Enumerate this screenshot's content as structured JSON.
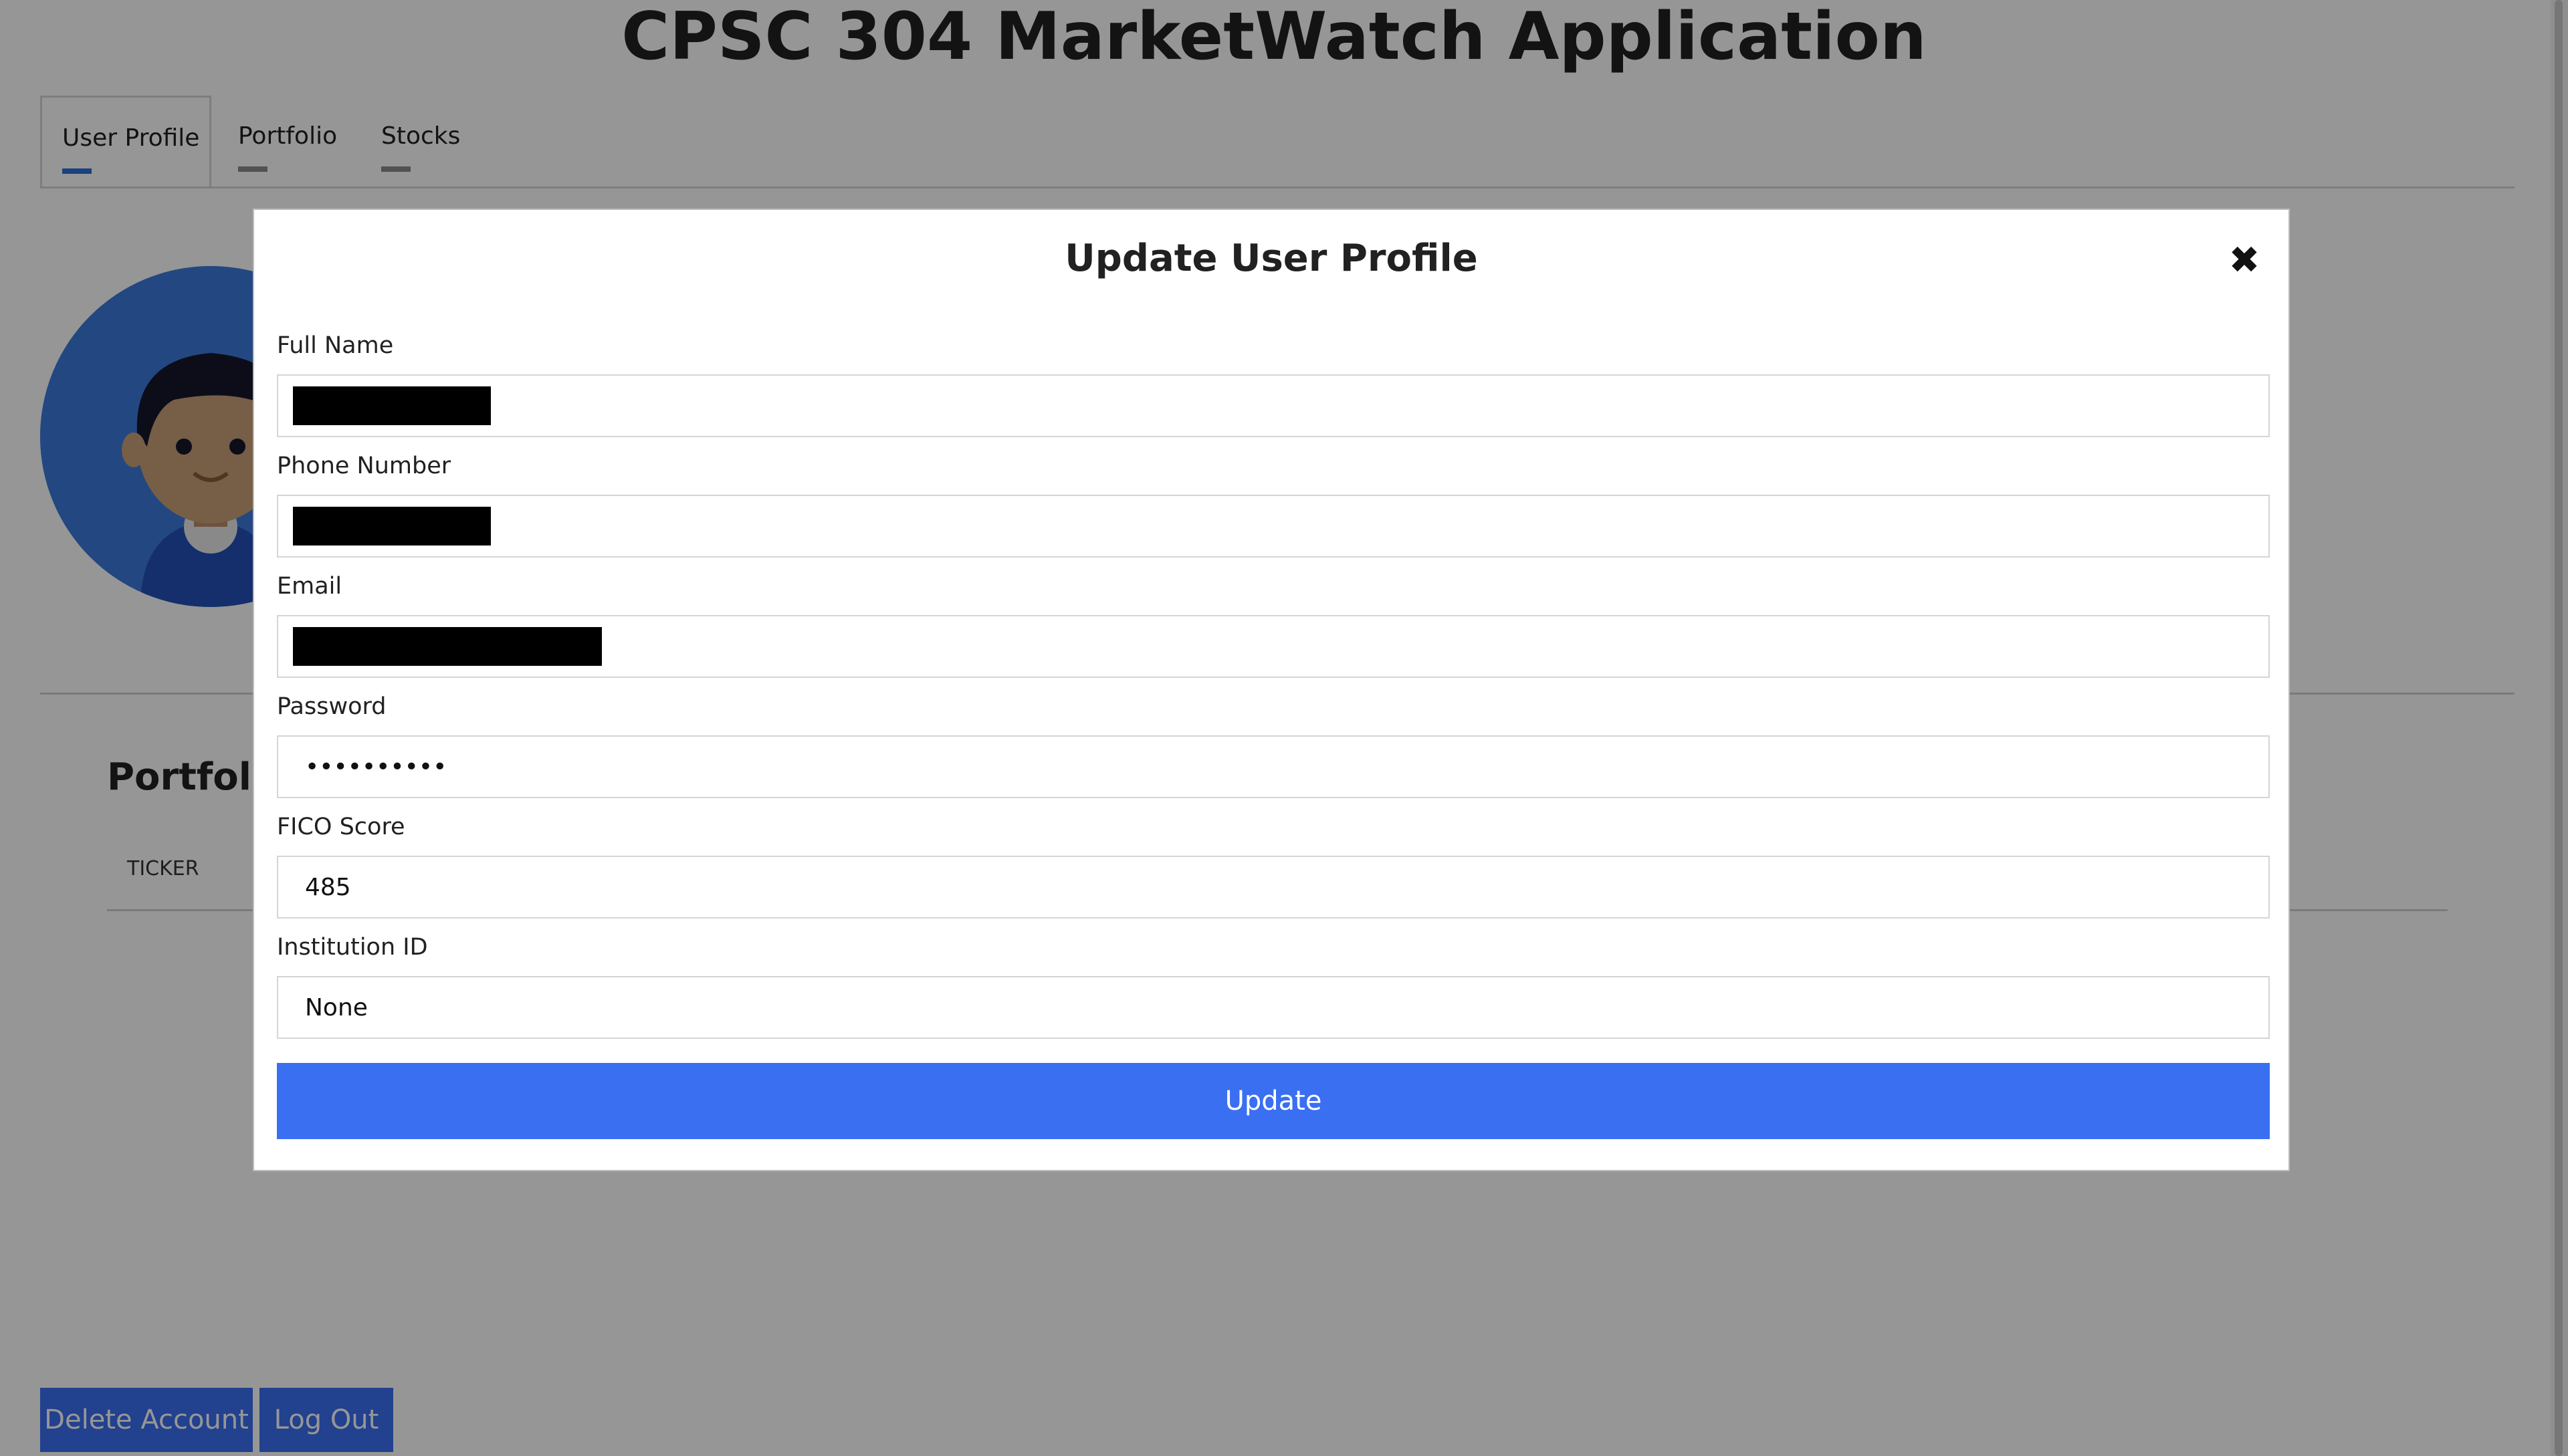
{
  "app": {
    "title": "CPSC 304 MarketWatch Application"
  },
  "tabs": [
    {
      "label": "User Profile",
      "active": true
    },
    {
      "label": "Portfolio",
      "active": false
    },
    {
      "label": "Stocks",
      "active": false
    }
  ],
  "profile": {
    "portfolio_heading": "Portfolio",
    "table_header_ticker": "TICKER"
  },
  "actions": {
    "delete_label": "Delete Account",
    "logout_label": "Log Out"
  },
  "modal": {
    "title": "Update User Profile",
    "close_glyph": "✖",
    "fields": {
      "full_name": {
        "label": "Full Name",
        "value_redacted": true
      },
      "phone": {
        "label": "Phone Number",
        "value_redacted": true
      },
      "email": {
        "label": "Email",
        "value_redacted": true
      },
      "password": {
        "label": "Password",
        "value": "••••••••••"
      },
      "fico": {
        "label": "FICO Score",
        "value": "485"
      },
      "institution": {
        "label": "Institution ID",
        "value": "None"
      }
    },
    "submit_label": "Update"
  },
  "colors": {
    "primary": "#3a6ff2",
    "overlay": "rgba(0,0,0,0.41)",
    "active_tab_indicator": "#2f6fd6"
  }
}
